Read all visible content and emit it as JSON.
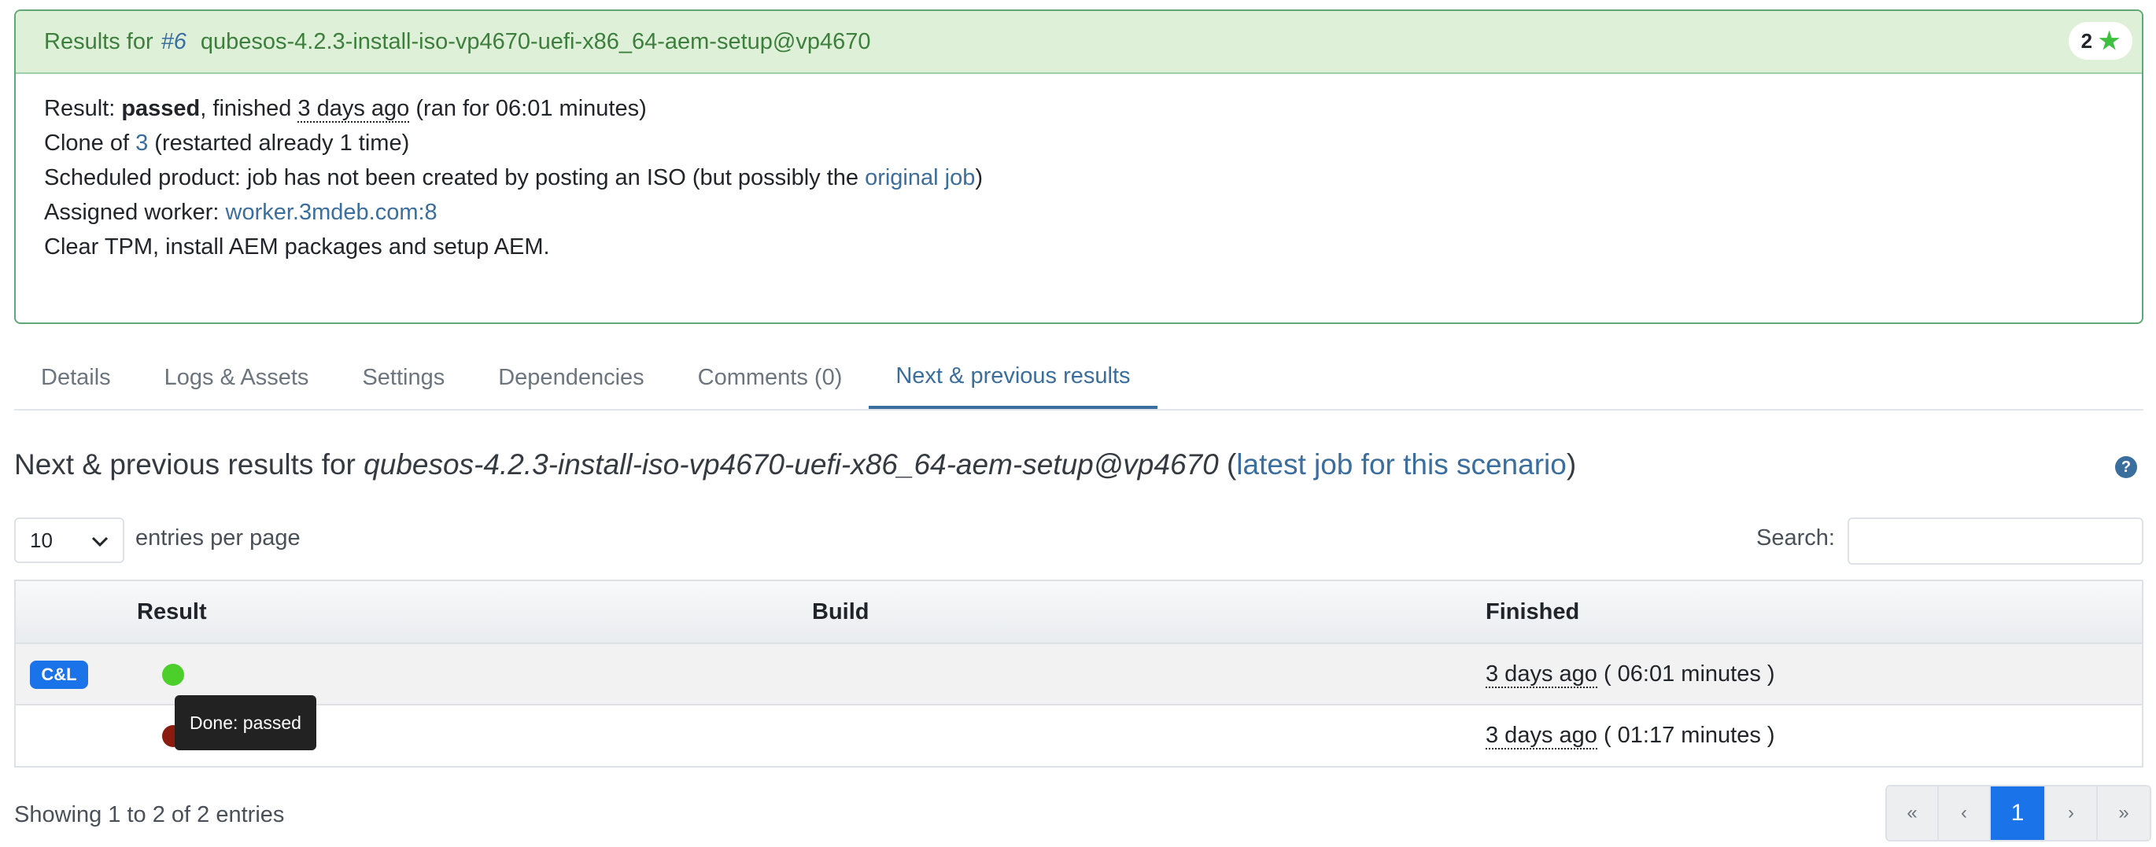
{
  "panel": {
    "title_prefix": "Results for",
    "job_id": "#6",
    "job_name": "qubesos-4.2.3-install-iso-vp4670-uefi-x86_64-aem-setup@vp4670",
    "star_count": "2",
    "result_label": "Result:",
    "result_value": "passed",
    "finished_text": ", finished",
    "finished_ago": "3 days ago",
    "ran_for": "(ran for 06:01 minutes)",
    "clone_prefix": "Clone of",
    "clone_id": "3",
    "clone_suffix": "(restarted already 1 time)",
    "scheduled_text": "Scheduled product: job has not been created by posting an ISO (but possibly the",
    "scheduled_link": "original job",
    "scheduled_close": ")",
    "worker_label": "Assigned worker:",
    "worker_value": "worker.3mdeb.com:8",
    "description": "Clear TPM, install AEM packages and setup AEM."
  },
  "tabs": [
    "Details",
    "Logs & Assets",
    "Settings",
    "Dependencies",
    "Comments (0)",
    "Next & previous results"
  ],
  "section": {
    "prefix": "Next & previous results for",
    "scenario": "qubesos-4.2.3-install-iso-vp4670-uefi-x86_64-aem-setup@vp4670",
    "open_paren": "(",
    "link": "latest job for this scenario",
    "close_paren": ")"
  },
  "controls": {
    "entries_value": "10",
    "entries_label": "entries per page",
    "search_label": "Search:",
    "search_value": ""
  },
  "table": {
    "headers": [
      "Result",
      "Build",
      "Finished"
    ],
    "rows": [
      {
        "badge": "C&L",
        "status": "passed",
        "finished_ago": "3 days ago",
        "duration": "( 06:01 minutes )"
      },
      {
        "badge": "",
        "status": "failed",
        "finished_ago": "3 days ago",
        "duration": "( 01:17 minutes )"
      }
    ]
  },
  "tooltip": "Done: passed",
  "footer": {
    "info": "Showing 1 to 2 of 2 entries",
    "pager": [
      "«",
      "‹",
      "1",
      "›",
      "»"
    ]
  },
  "colors": {
    "panel_header_bg": "#dff0d8",
    "link": "#3a6e9e",
    "pass": "#4ccf2a",
    "fail": "#8b1a0f",
    "accent": "#1a73e8"
  }
}
